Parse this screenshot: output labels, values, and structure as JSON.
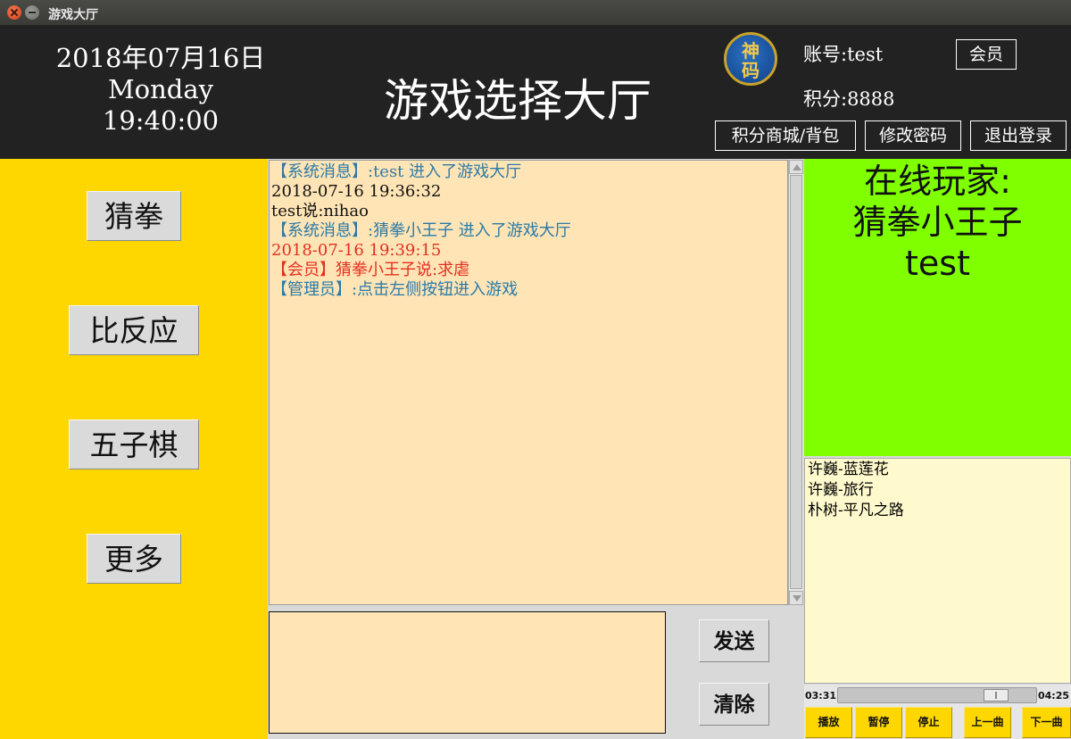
{
  "window": {
    "title": "游戏大厅"
  },
  "header": {
    "date": "2018年07月16日",
    "weekday": "Monday",
    "time": "19:40:00",
    "title": "游戏选择大厅",
    "logo_text_1": "神",
    "logo_text_2": "码",
    "account": "账号:test",
    "points": "积分:8888",
    "member_label": "会员",
    "shop_label": "积分商城/背包",
    "change_password_label": "修改密码",
    "logout_label": "退出登录"
  },
  "games": [
    {
      "label": "猜拳"
    },
    {
      "label": "比反应"
    },
    {
      "label": "五子棋"
    },
    {
      "label": "更多"
    }
  ],
  "chat": {
    "messages": [
      {
        "text": "【系统消息】:test 进入了游戏大厅",
        "color": "#2a7aa8"
      },
      {
        "text": "2018-07-16 19:36:32",
        "color": "#111111"
      },
      {
        "text": "test说:nihao",
        "color": "#111111"
      },
      {
        "text": "【系统消息】:猜拳小王子 进入了游戏大厅",
        "color": "#2a7aa8"
      },
      {
        "text": "2018-07-16 19:39:15",
        "color": "#e03020"
      },
      {
        "text": "【会员】猜拳小王子说:求虐",
        "color": "#e03020"
      },
      {
        "text": "【管理员】:点击左侧按钮进入游戏",
        "color": "#2a7aa8"
      }
    ],
    "input_value": "",
    "send_label": "发送",
    "clear_label": "清除"
  },
  "online": {
    "title": "在线玩家:",
    "players": [
      "猜拳小王子",
      "test"
    ]
  },
  "music": {
    "playlist": [
      "许巍-蓝莲花",
      "许巍-旅行",
      "朴树-平凡之路"
    ],
    "current_time": "03:31",
    "total_time": "04:25",
    "progress": 0.8,
    "play_label": "播放",
    "pause_label": "暂停",
    "stop_label": "停止",
    "prev_label": "上一曲",
    "next_label": "下一曲"
  },
  "colors": {
    "header_bg": "#222222",
    "left_panel_bg": "#ffd700",
    "chat_bg": "#ffe4b5",
    "online_bg": "#7fff00",
    "playlist_bg": "#fffacd"
  }
}
